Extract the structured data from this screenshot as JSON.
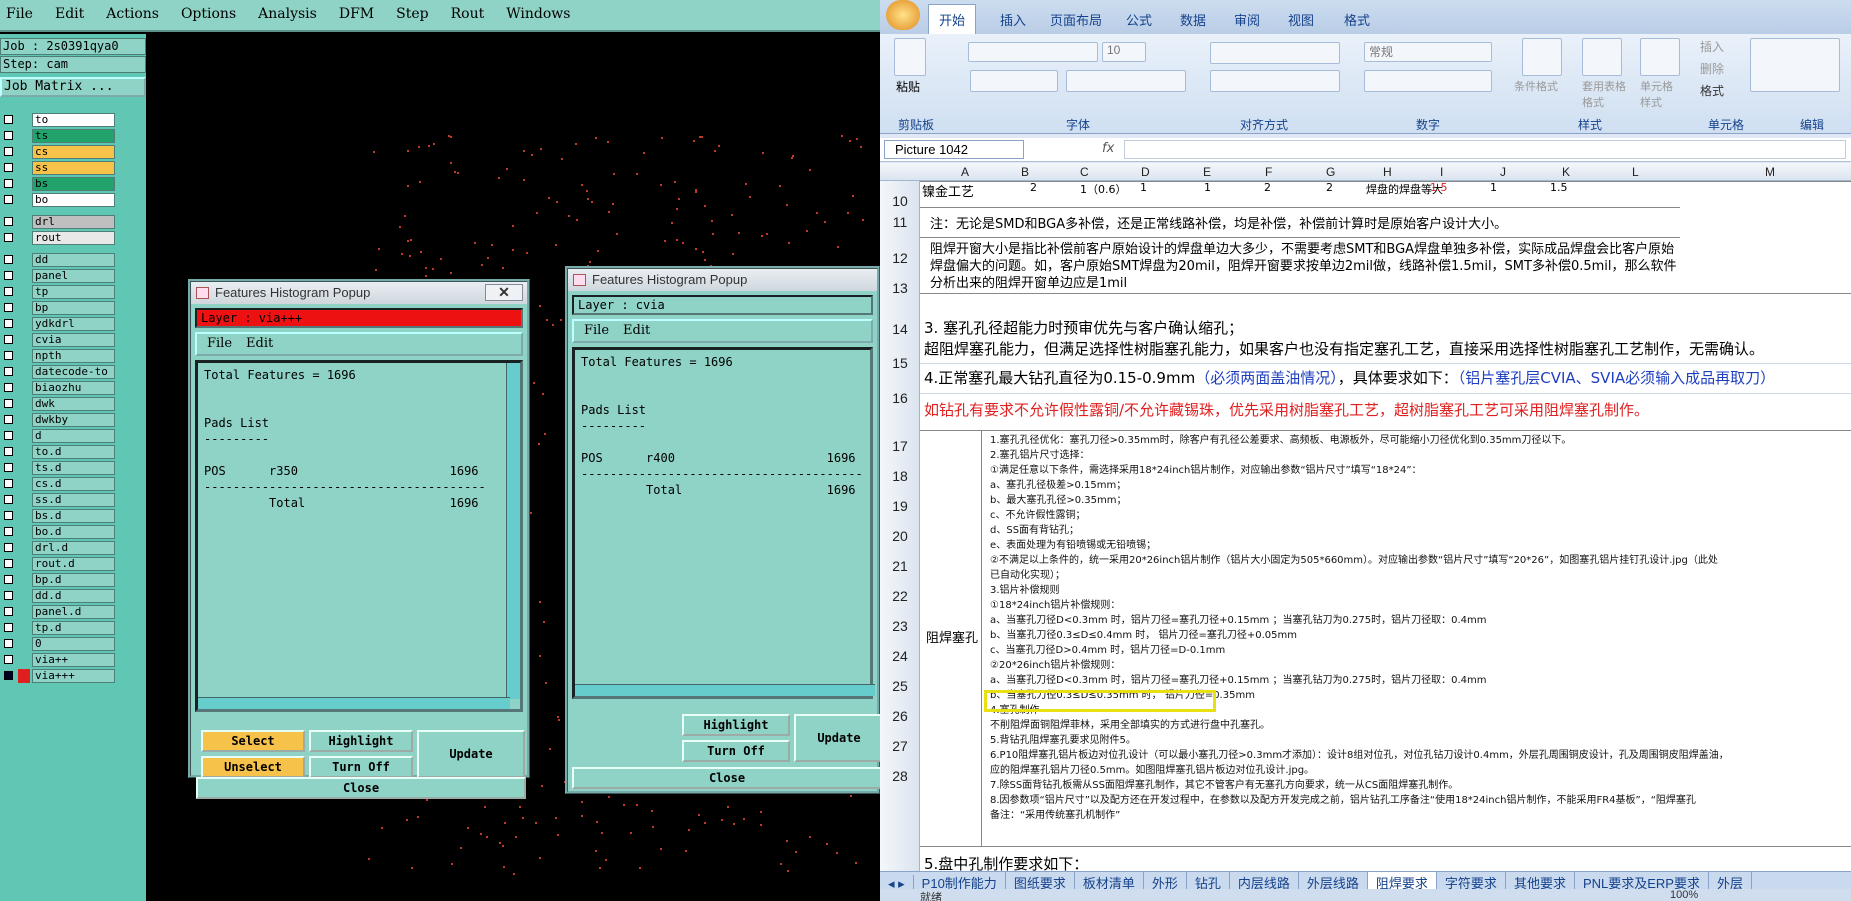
{
  "cam": {
    "menu": [
      "File",
      "Edit",
      "Actions",
      "Options",
      "Analysis",
      "DFM",
      "Step",
      "Rout",
      "Windows"
    ],
    "job": "Job : 2s0391qya0",
    "step": "Step: cam",
    "job_matrix": "Job Matrix ...",
    "layers_group1": [
      {
        "name": "to",
        "color": "#ffffff"
      },
      {
        "name": "ts",
        "color": "#22a36b"
      },
      {
        "name": "cs",
        "color": "#f7c24a"
      },
      {
        "name": "ss",
        "color": "#f7c24a"
      },
      {
        "name": "bs",
        "color": "#22a36b"
      },
      {
        "name": "bo",
        "color": "#ffffff"
      }
    ],
    "layers_group2": [
      {
        "name": "drl",
        "color": "#bfbfbf"
      },
      {
        "name": "rout",
        "color": "#e8e8e8"
      }
    ],
    "layers_group3": [
      "dd",
      "panel",
      "tp",
      "bp",
      "ydkdrl",
      "cvia",
      "npth",
      "datecode-to",
      "biaozhu",
      "dwk",
      "dwkby",
      "d",
      "to.d",
      "ts.d",
      "cs.d",
      "ss.d",
      "bs.d",
      "bo.d",
      "drl.d",
      "rout.d",
      "bp.d",
      "dd.d",
      "panel.d",
      "tp.d",
      "0",
      "via++",
      "via+++"
    ]
  },
  "popup1": {
    "title": "Features Histogram Popup",
    "layer_label": "Layer :  via+++",
    "menu": [
      "File",
      "Edit"
    ],
    "text": "Total Features = 1696\n\n\nPads List\n---------\n\nPOS      r350                     1696\n---------------------------------------\n         Total                    1696",
    "select": "Select",
    "highlight": "Highlight",
    "unselect": "Unselect",
    "turn_off": "Turn Off",
    "update": "Update",
    "close": "Close"
  },
  "popup2": {
    "title": "Features Histogram Popup",
    "layer_label": "Layer :  cvia",
    "menu": [
      "File",
      "Edit"
    ],
    "text": "Total Features = 1696\n\n\nPads List\n---------\n\nPOS      r400                     1696\n---------------------------------------\n         Total                    1696",
    "highlight": "Highlight",
    "turn_off": "Turn Off",
    "update": "Update",
    "close": "Close"
  },
  "excel": {
    "tabs": [
      "开始",
      "插入",
      "页面布局",
      "公式",
      "数据",
      "审阅",
      "视图",
      "格式"
    ],
    "groups": [
      "剪贴板",
      "字体",
      "对齐方式",
      "数字",
      "样式",
      "单元格",
      "编辑"
    ],
    "ribbon_labels": {
      "paste": "粘贴",
      "font_size": "10",
      "number_format": "常规",
      "cond_format": "条件格式",
      "table_format": "套用表格格式",
      "cell_style": "单元格样式",
      "insert": "插入",
      "delete": "删除",
      "format": "格式",
      "fx": "fx"
    },
    "name_box": "Picture 1042",
    "columns": [
      "A",
      "B",
      "C",
      "D",
      "E",
      "F",
      "G",
      "H",
      "I",
      "J",
      "K",
      "L",
      "M"
    ],
    "rows": [
      "10",
      "11",
      "12",
      "13",
      "14",
      "15",
      "16",
      "17",
      "18",
      "19",
      "20",
      "21",
      "22",
      "23",
      "24",
      "25",
      "26",
      "27",
      "28"
    ],
    "row10_a": "镍金工艺",
    "row10_vals": [
      "2",
      "1（0.6）",
      "1",
      "1",
      "2",
      "2",
      "焊盘的焊盘等大",
      "1.5",
      "1",
      "1.5"
    ],
    "row11": "注：无论是SMD和BGA多补偿，还是正常线路补偿，均是补偿，补偿前计算时是原始客户设计大小。",
    "row12": "阻焊开窗大小是指比补偿前客户原始设计的焊盘单边大多少，不需要考虑SMT和BGA焊盘单独多补偿，实际成品焊盘会比客户原始焊盘偏大的问题。如，客户原始SMT焊盘为20mil，阻焊开窗要求按单边2mil做，线路补偿1.5mil，SMT多补偿0.5mil，那么软件分析出来的阻焊开窗单边应是1mil",
    "row14a": "3. 塞孔孔径超能力时预审优先与客户确认缩孔；",
    "row14b": "超阻焊塞孔能力，但满足选择性树脂塞孔能力，如果客户也没有指定塞孔工艺，直接采用选择性树脂塞孔工艺制作，无需确认。",
    "row15a": "4.正常塞孔最大钻孔直径为0.15-0.9mm",
    "row15b": "（必须两面盖油情况）",
    "row15c": "，具体要求如下：",
    "row15d": "（铝片塞孔层CVIA、SVIA必须输入成品再取刀）",
    "row16": "如钻孔有要求不允许假性露铜/不允许藏锡珠，优先采用树脂塞孔工艺，超树脂塞孔工艺可采用阻焊塞孔制作。",
    "merged_a": "阻焊塞孔",
    "notes": "1.塞孔孔径优化：塞孔刀径>0.35mm时，除客户有孔径公差要求、高频板、电源板外，尽可能缩小刀径优化到0.35mm刀径以下。\n2.塞孔铝片尺寸选择：\n①满足任意以下条件，需选择采用18*24inch铝片制作，对应输出参数“铝片尺寸”填写“18*24”：\na、塞孔孔径极差>0.15mm；\nb、最大塞孔孔径>0.35mm；\nc、不允许假性露铜；\nd、SS面有背钻孔；\ne、表面处理为有铅喷锡或无铅喷锡；\n②不满足以上条件的，统一采用20*26inch铝片制作（铝片大小固定为505*660mm）。对应输出参数“铝片尺寸”填写“20*26”，如图塞孔铝片挂钉孔设计.jpg（此处\n已自动化实现）；\n3.铝片补偿规则\n①18*24inch铝片补偿规则：\na、当塞孔刀径D<0.3mm 时，铝片刀径=塞孔刀径+0.15mm ；当塞孔钻刀为0.275时，铝片刀径取：0.4mm\nb、当塞孔刀径0.3≤D≤0.4mm 时， 铝片刀径=塞孔刀径+0.05mm\nc、当塞孔刀径D>0.4mm 时，铝片刀径=D-0.1mm\n②20*26inch铝片补偿规则：\na、当塞孔刀径D<0.3mm 时，铝片刀径=塞孔刀径+0.15mm ；当塞孔钻刀为0.275时，铝片刀径取：0.4mm\nb、当塞孔刀径0.3≤D≤0.35mm 时， 铝片刀径=0.35mm\n4.塞孔制作\n不削阻焊面铜阻焊菲林，采用全部填实的方式进行盘中孔塞孔。\n5.背钻孔阻焊塞孔要求见附件5。\n6.P10阻焊塞孔铝片板边对位孔设计（可以最小塞孔刀径>0.3mm才添加）：设计8组对位孔，对位孔钻刀设计0.4mm，外层孔周围铜皮设计，孔及周围铜皮阻焊盖油，\n应的阻焊塞孔铝片刀径0.5mm。如图阻焊塞孔铝片板边对位孔设计.jpg。\n7.除SS面背钻孔板需从SS面阻焊塞孔制作，其它不管客户有无塞孔方向要求，统一从CS面阻焊塞孔制作。\n8.因参数项“铝片尺寸”以及配方还在开发过程中，在参数以及配方开发完成之前，铝片钻孔工序备注“使用18*24inch铝片制作，不能采用FR4基板”，“阻焊塞孔\n备注：“采用传统塞孔机制作”",
    "row28": "5.盘中孔制作要求如下：",
    "sheet_tabs": [
      "P10制作能力",
      "图纸要求",
      "板材清单",
      "外形",
      "钻孔",
      "内层线路",
      "外层线路",
      "阻焊要求",
      "字符要求",
      "其他要求",
      "PNL要求及ERP要求",
      "外层"
    ],
    "active_sheet": "阻焊要求",
    "status": "就绪",
    "zoom": "100%",
    "colors": {
      "red": "#e02020",
      "blue": "#1f3fbf",
      "highlight": "#e8e010"
    }
  }
}
